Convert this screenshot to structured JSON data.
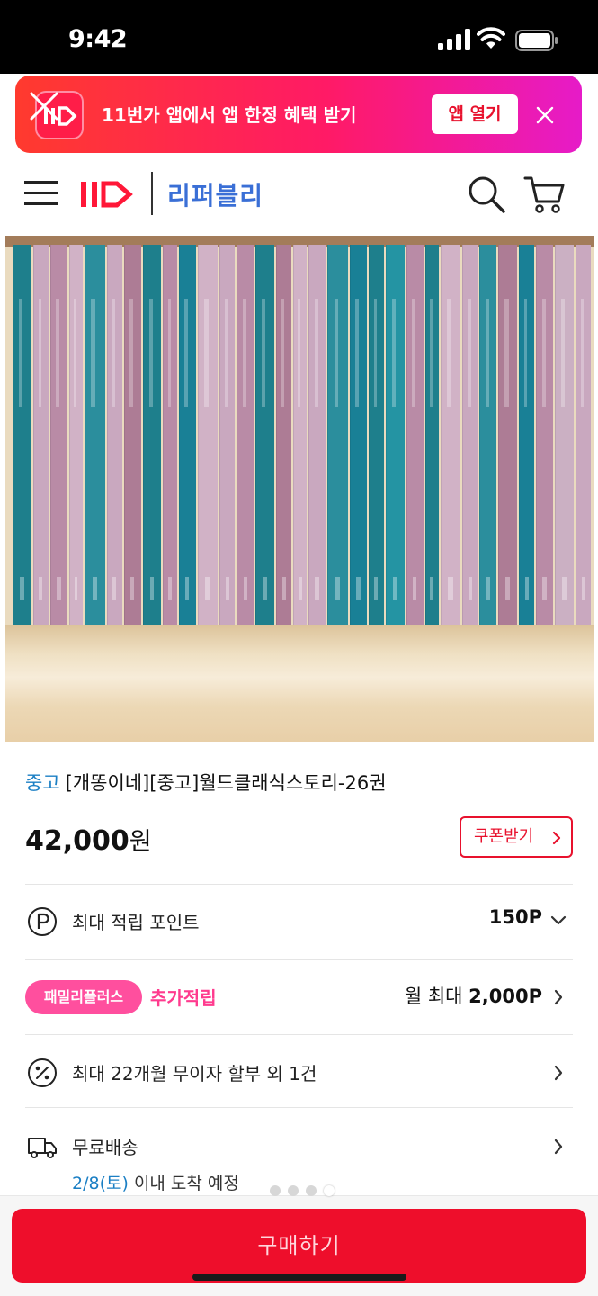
{
  "status": {
    "time": "9:42"
  },
  "banner": {
    "text": "11번가 앱에서 앱 한정 혜택 받기",
    "open_label": "앱 열기",
    "close_icon": "close-icon",
    "gradient": [
      "#ff3a2e",
      "#ff1a66",
      "#e61bc8"
    ]
  },
  "header": {
    "brand": "11",
    "store_name": "리퍼블리"
  },
  "product": {
    "condition": "중고",
    "title": "[개똥이네][중고]월드클래식스토리-26권",
    "price": "42,000",
    "currency": "원",
    "coupon_label": "쿠폰받기"
  },
  "rows": {
    "points": {
      "label": "최대 적립 포인트",
      "value": "150P"
    },
    "family": {
      "badge": "패밀리플러스",
      "extra": "추가적립",
      "value_prefix": "월 최대",
      "value": "2,000P"
    },
    "installment": {
      "label": "최대 22개월 무이자 할부 외 1건"
    },
    "delivery": {
      "label": "무료배송",
      "date": "2/8(토)",
      "eta": "이내 도착 예정"
    }
  },
  "buy_button": "구매하기",
  "colors": {
    "accent_red": "#ee0e2b",
    "link_blue": "#1b7fc4",
    "family_pink": "#ff4f9e",
    "store_blue": "#3a6fd6"
  }
}
